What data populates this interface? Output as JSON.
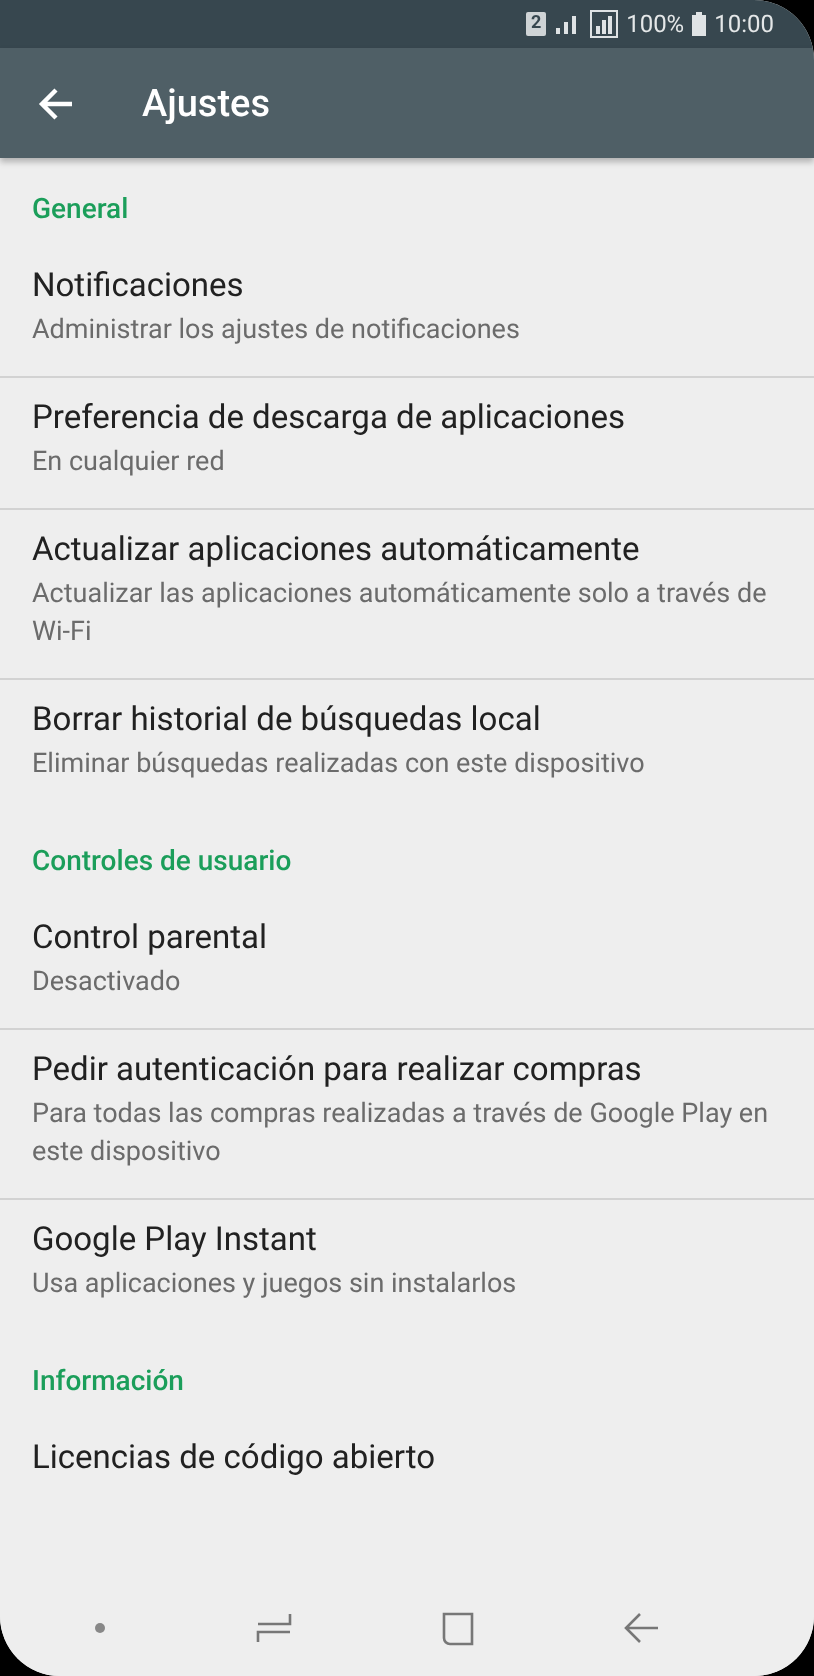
{
  "status_bar": {
    "sim": "2",
    "battery": "100%",
    "time": "10:00"
  },
  "toolbar": {
    "title": "Ajustes"
  },
  "sections": [
    {
      "title": "General",
      "items": [
        {
          "title": "Notificaciones",
          "subtitle": "Administrar los ajustes de notificaciones"
        },
        {
          "title": "Preferencia de descarga de aplicaciones",
          "subtitle": "En cualquier red"
        },
        {
          "title": "Actualizar aplicaciones automáticamente",
          "subtitle": "Actualizar las aplicaciones automáticamente solo a través de Wi-Fi"
        },
        {
          "title": "Borrar historial de búsquedas local",
          "subtitle": "Eliminar búsquedas realizadas con este dispositivo"
        }
      ]
    },
    {
      "title": "Controles de usuario",
      "items": [
        {
          "title": "Control parental",
          "subtitle": "Desactivado"
        },
        {
          "title": "Pedir autenticación para realizar compras",
          "subtitle": "Para todas las compras realizadas a través de Google Play en este dispositivo"
        },
        {
          "title": "Google Play Instant",
          "subtitle": "Usa aplicaciones y juegos sin instalarlos"
        }
      ]
    },
    {
      "title": "Información",
      "items": [
        {
          "title": "Licencias de código abierto"
        }
      ]
    }
  ]
}
